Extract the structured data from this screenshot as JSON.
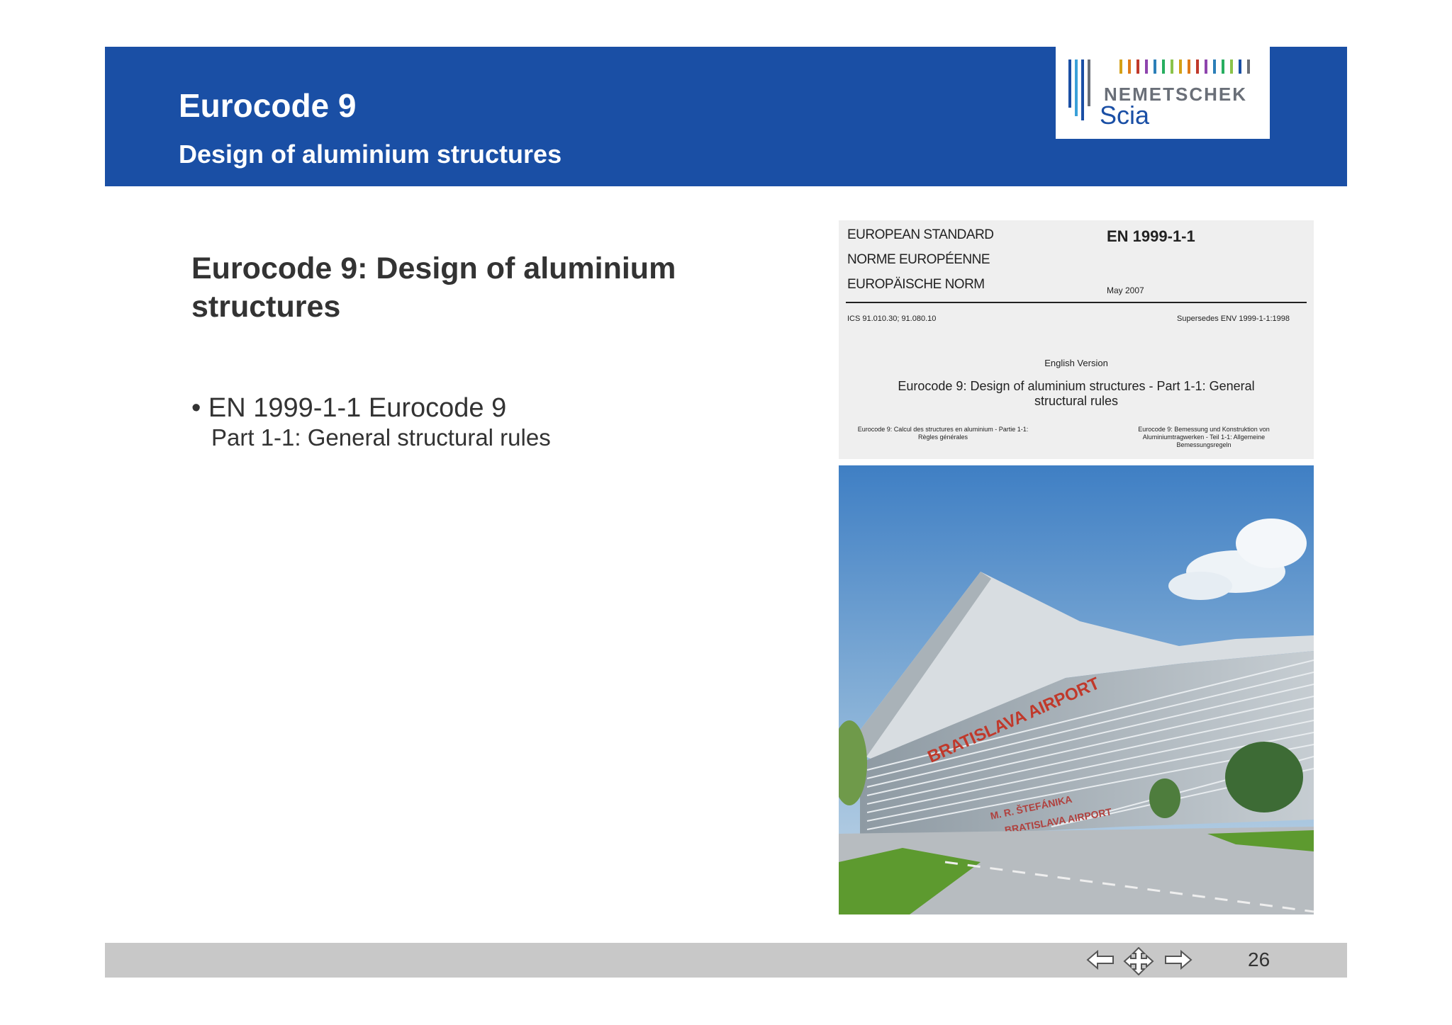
{
  "header": {
    "title": "Eurocode 9",
    "subtitle": "Design of aluminium structures",
    "logo": {
      "word": "NEMETSCHEK",
      "sub": "Scia"
    }
  },
  "content": {
    "heading": "Eurocode 9: Design of aluminium structures",
    "bullet": "• EN 1999-1-1 Eurocode 9",
    "bullet_sub": "Part 1-1: General structural rules"
  },
  "document": {
    "lang1": "EUROPEAN STANDARD",
    "lang2": "NORME EUROPÉENNE",
    "lang3": "EUROPÄISCHE NORM",
    "number": "EN 1999-1-1",
    "date": "May 2007",
    "ics": "ICS 91.010.30; 91.080.10",
    "supersedes": "Supersedes ENV 1999-1-1:1998",
    "version": "English Version",
    "title": "Eurocode 9: Design of aluminium structures - Part 1-1: General structural rules",
    "french": "Eurocode 9: Calcul des structures en aluminium - Partie 1-1: Règles générales",
    "german": "Eurocode 9: Bemessung und Konstruktion von Aluminiumtragwerken - Teil 1-1: Allgemeine Bemessungsregeln"
  },
  "photo": {
    "sign_main": "BRATISLAVA AIRPORT",
    "sign_lower1": "M. R. ŠTEFÁNIKA",
    "sign_lower2": "BRATISLAVA AIRPORT"
  },
  "footer": {
    "page_number": "26",
    "icons": [
      "arrow-left-icon",
      "move-icon",
      "arrow-right-icon"
    ]
  },
  "colors": {
    "header_blue": "#1a4fa5",
    "footer_gray": "#c8c8c8",
    "text_dark": "#333333"
  }
}
